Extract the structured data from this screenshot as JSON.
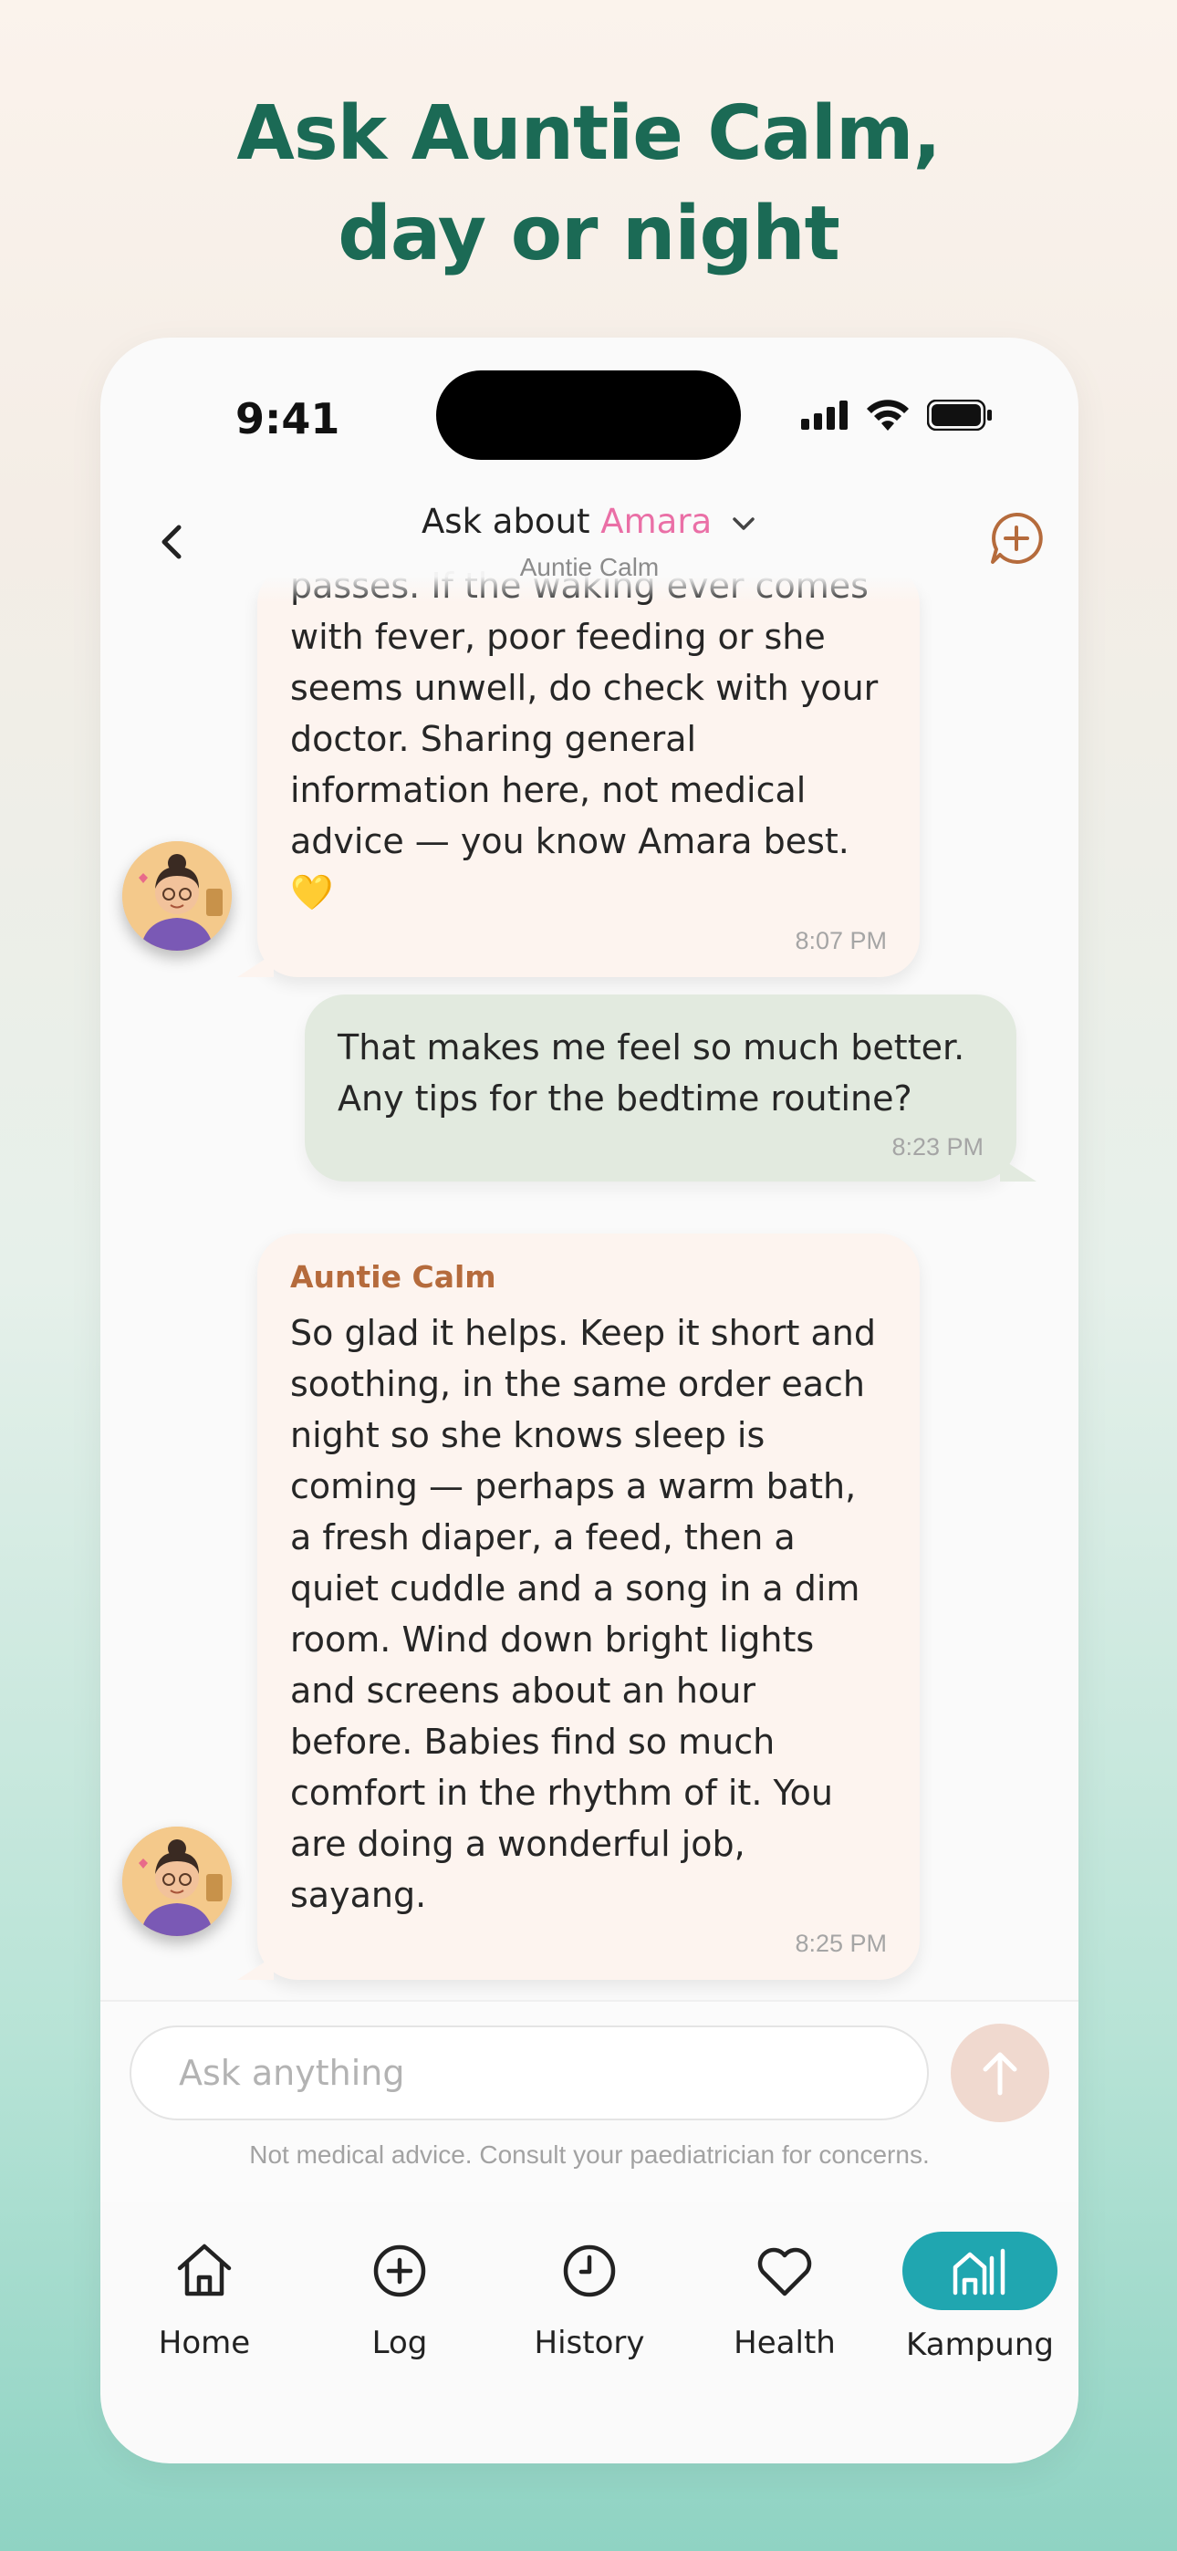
{
  "headline": {
    "line1": "Ask Auntie Calm,",
    "line2": "day or night"
  },
  "status_bar": {
    "time": "9:41"
  },
  "chat_header": {
    "title_prefix": "Ask about ",
    "child_name": "Amara",
    "subtitle": "Auntie Calm",
    "back_icon": "chevron-left-icon",
    "new_chat_icon": "chat-plus-icon"
  },
  "messages": [
    {
      "from": "bot",
      "text": "passes. If the waking ever comes with fever, poor feeding or she seems unwell, do check with your doctor. Sharing general information here, not medical advice — you know Amara best. 💛",
      "time": "8:07 PM"
    },
    {
      "from": "user",
      "text": "That makes me feel so much better. Any tips for the bedtime routine?",
      "time": "8:23 PM"
    },
    {
      "from": "bot",
      "sender": "Auntie Calm",
      "text": "So glad it helps. Keep it short and soothing, in the same order each night so she knows sleep is coming — perhaps a warm bath, a fresh diaper, a feed, then a quiet cuddle and a song in a dim room. Wind down bright lights and screens about an hour before. Babies find so much comfort in the rhythm of it. You are doing a wonderful job, sayang.",
      "time": "8:25 PM"
    }
  ],
  "composer": {
    "placeholder": "Ask anything",
    "send_icon": "arrow-up-icon",
    "disclaimer": "Not medical advice. Consult your paediatrician for concerns."
  },
  "tabs": [
    {
      "label": "Home",
      "icon": "home-icon"
    },
    {
      "label": "Log",
      "icon": "plus-circle-icon"
    },
    {
      "label": "History",
      "icon": "clock-icon"
    },
    {
      "label": "Health",
      "icon": "heart-icon"
    },
    {
      "label": "Kampung",
      "icon": "community-icon",
      "active": true
    }
  ],
  "colors": {
    "headline": "#1b6a55",
    "accent_name": "#ea6fa6",
    "sender_name": "#b56b3c",
    "active_tab": "#20a6b0",
    "bot_bubble": "#fdf4ef",
    "user_bubble": "#e2eadf"
  }
}
